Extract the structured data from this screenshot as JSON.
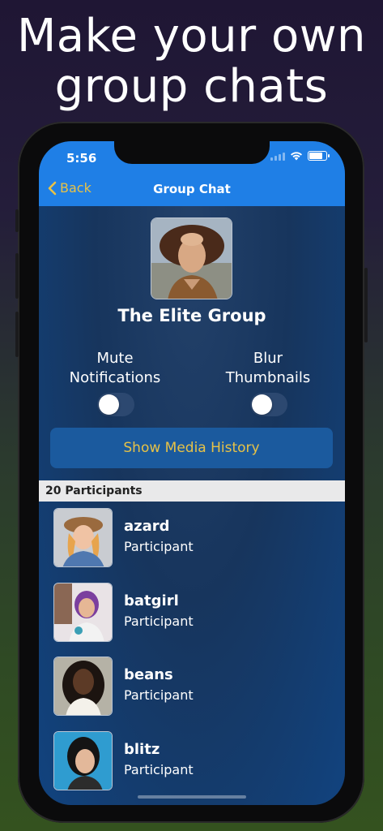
{
  "headline": {
    "line1": "Make your own",
    "line2": "group chats"
  },
  "status_bar": {
    "time": "5:56"
  },
  "nav": {
    "back_label": "Back",
    "title": "Group Chat"
  },
  "group": {
    "name": "The Elite Group"
  },
  "toggles": [
    {
      "label_line1": "Mute",
      "label_line2": "Notifications",
      "on": false
    },
    {
      "label_line1": "Blur",
      "label_line2": "Thumbnails",
      "on": false
    }
  ],
  "media_button": {
    "label": "Show Media History"
  },
  "participants_header": "20 Participants",
  "participants": [
    {
      "name": "azard",
      "role": "Participant"
    },
    {
      "name": "batgirl",
      "role": "Participant"
    },
    {
      "name": "beans",
      "role": "Participant"
    },
    {
      "name": "blitz",
      "role": "Participant"
    }
  ],
  "colors": {
    "accent": "#e7c247",
    "nav_bar": "#1f7fe6",
    "screen_bg": "#17355d",
    "button_bg": "#1b5a9e"
  }
}
